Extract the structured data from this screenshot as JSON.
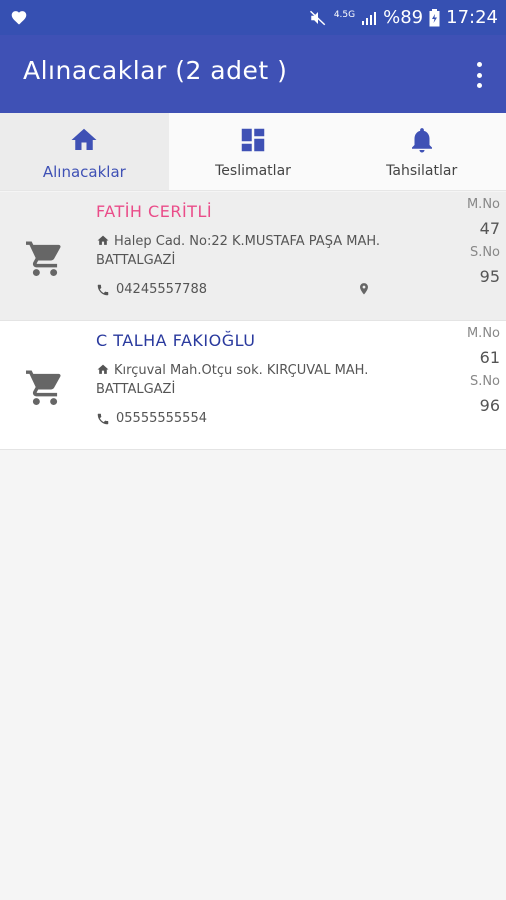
{
  "status_bar": {
    "network": "4.5G",
    "battery": "%89",
    "time": "17:24"
  },
  "app_bar": {
    "title": "Alınacaklar (2 adet )"
  },
  "tabs": [
    {
      "label": "Alınacaklar",
      "icon": "home-icon",
      "active": true
    },
    {
      "label": "Teslimatlar",
      "icon": "dashboard-icon",
      "active": false
    },
    {
      "label": "Tahsilatlar",
      "icon": "bell-icon",
      "active": false
    }
  ],
  "items": [
    {
      "name": "FATİH CERİTLİ",
      "name_color": "#ea4c89",
      "address": "Halep Cad. No:22 K.MUSTAFA PAŞA MAH. BATTALGAZİ",
      "phone": "04245557788",
      "m_label": "M.No",
      "m_value": "47",
      "s_label": "S.No",
      "s_value": "95",
      "has_location": true
    },
    {
      "name": "C TALHA FAKIOĞLU",
      "name_color": "#2a3a9e",
      "address": "Kırçuval Mah.Otçu sok. KIRÇUVAL MAH. BATTALGAZİ",
      "phone": "05555555554",
      "m_label": "M.No",
      "m_value": "61",
      "s_label": "S.No",
      "s_value": "96",
      "has_location": false
    }
  ],
  "colors": {
    "primary": "#3f51b5",
    "status_bar": "#3650b2",
    "icon_gray": "#666666"
  }
}
